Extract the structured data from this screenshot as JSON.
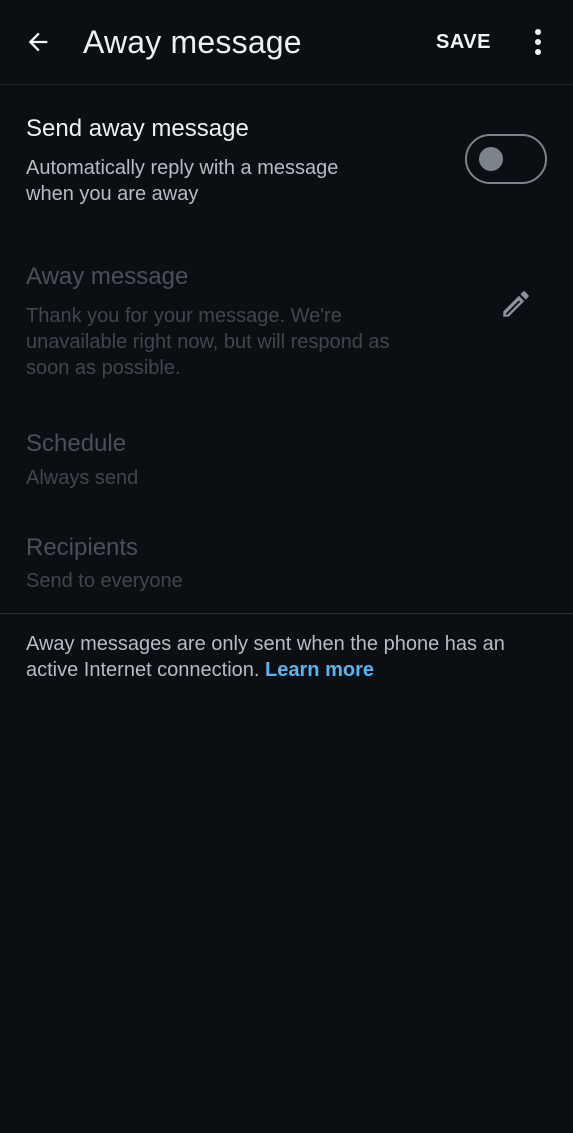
{
  "appbar": {
    "back_icon": "arrow-back-icon",
    "title": "Away message",
    "save_label": "SAVE",
    "more_icon": "more-vert-icon"
  },
  "send_away": {
    "title": "Send away message",
    "subtitle_line1": "Automatically reply with a message",
    "subtitle_line2": "when you are away",
    "enabled": false
  },
  "message": {
    "title": "Away message",
    "line1": "Thank you for your message. We're",
    "line2": "unavailable right now, but will respond as",
    "line3": "soon as possible.",
    "edit_icon": "pencil-icon"
  },
  "schedule": {
    "title": "Schedule",
    "value": "Always send"
  },
  "recipients": {
    "title": "Recipients",
    "value": "Send to everyone"
  },
  "footer": {
    "text": "Away messages are only sent when the phone has an active Internet connection.",
    "link": "Learn more"
  },
  "colors": {
    "background": "#0b0f14",
    "link": "#5ab4f0",
    "disabled_text": "#4a5058"
  }
}
